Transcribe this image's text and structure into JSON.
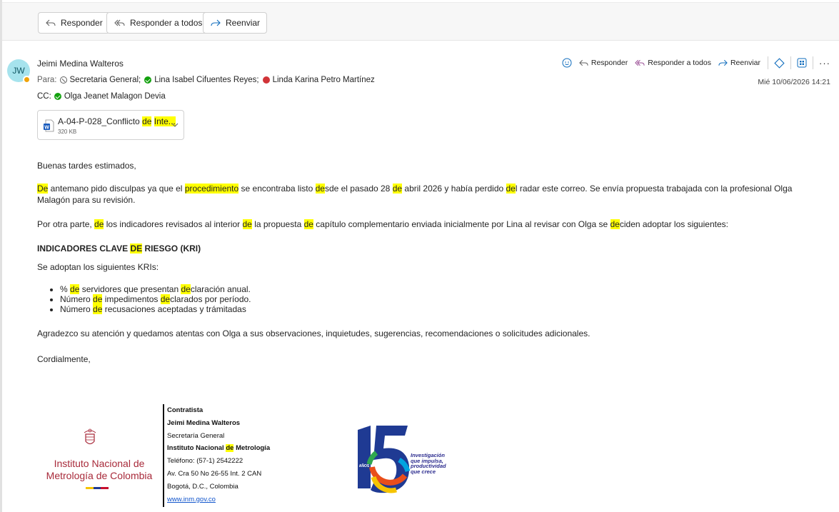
{
  "toolbar": {
    "reply_label": "Responder",
    "reply_all_label": "Responder a todos",
    "forward_label": "Reenviar"
  },
  "message": {
    "avatar_initials": "JW",
    "sender": "Jeimi Medina Walteros",
    "to_label": "Para:",
    "to": [
      {
        "name": "Secretaria General;",
        "status": "unknown"
      },
      {
        "name": "Lina Isabel Cifuentes Reyes;",
        "status": "available"
      },
      {
        "name": "Linda Karina Petro Martínez",
        "status": "busy"
      }
    ],
    "cc_label": "CC:",
    "cc": [
      {
        "name": "Olga Jeanet Malagon Devia",
        "status": "available"
      }
    ],
    "actions": {
      "reply": "Responder",
      "reply_all": "Responder a todos",
      "forward": "Reenviar"
    },
    "date": "Mié 10/06/2026 14:21",
    "attachment": {
      "name_start": "A-04-P-028_Conflicto ",
      "name_hl1": "de",
      "name_space": " ",
      "name_hl2": "Inte...",
      "size": "320 KB"
    }
  },
  "body": {
    "greeting": "Buenas tardes estimados,",
    "p2": {
      "s1": "De",
      "s2": " antemano pido disculpas ya que el ",
      "s3": "procedimiento",
      "s4": " se encontraba listo ",
      "s5": "de",
      "s6": "sde el pasado 28 ",
      "s7": "de",
      "s8": " abril 2026 y había perdido ",
      "s9": "de",
      "s10": "l radar este correo. Se envía propuesta trabajada con la profesional Olga Malagón para su revisión."
    },
    "p3": {
      "s1": "Por otra parte, ",
      "s2": "de",
      "s3": " los indicadores revisados al interior ",
      "s4": "de",
      "s5": " la propuesta ",
      "s6": "de",
      "s7": " capítulo complementario enviada inicialmente por Lina al revisar con Olga se ",
      "s8": "de",
      "s9": "ciden adoptar los siguientes:"
    },
    "heading": {
      "s1": "INDICADORES CLAVE ",
      "s2": "DE",
      "s3": " RIESGO (KRI)"
    },
    "intro": "Se adoptan los siguientes KRIs:",
    "list": [
      {
        "a": "% ",
        "b": "de",
        "c": " servidores que presentan ",
        "d": "de",
        "e": "claración anual."
      },
      {
        "a": "Número ",
        "b": "de",
        "c": " impedimentos ",
        "d": "de",
        "e": "clarados por período."
      },
      {
        "a": "Número ",
        "b": "de",
        "c": " recusaciones aceptadas y trámitadas",
        "d": "",
        "e": ""
      }
    ],
    "thanks": "Agradezco su atención y quedamos atentas con Olga a sus observaciones, inquietudes, sugerencias, recomendaciones o solicitudes adicionales.",
    "closing": "Cordialmente,"
  },
  "signature": {
    "org_logo_line1": "Instituto Nacional de",
    "org_logo_line2": "Metrología de Colombia",
    "role": "Contratista",
    "name": "Jeimi Medina Walteros",
    "dept": "Secretaría General",
    "org_a": "Instituto Nacional ",
    "org_hl": "de",
    "org_b": " Metrología",
    "phone": "Teléfono: (57-1) 2542222",
    "address": "Av. Cra 50 No 26-55 Int. 2 CAN",
    "city": "Bogotá, D.C., Colombia",
    "web": "www.inm.gov.co",
    "anniversary_number": "15",
    "anniversary_years": "AÑOS",
    "anniversary_slogan": [
      "Investigación",
      "que impulsa,",
      "productividad",
      "que crece"
    ]
  },
  "colors": {
    "highlight": "#ffff00",
    "avatar_bg": "#a6e3ed",
    "brand_red": "#a82a3a",
    "brand_blue": "#2b2b8e"
  }
}
